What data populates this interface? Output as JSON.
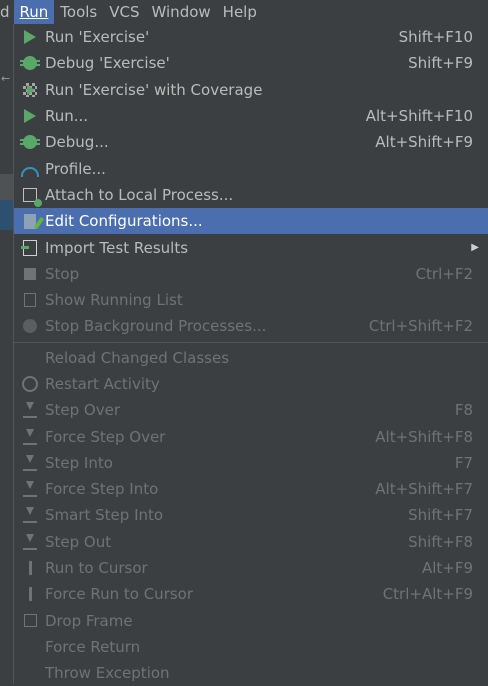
{
  "menubar": {
    "items": [
      {
        "label": "d",
        "underline": ""
      },
      {
        "label": "Run",
        "underline": "R"
      },
      {
        "label": "Tools",
        "underline": "T"
      },
      {
        "label": "VCS",
        "underline": ""
      },
      {
        "label": "Window",
        "underline": "W"
      },
      {
        "label": "Help",
        "underline": "H"
      }
    ]
  },
  "menu": {
    "items": [
      {
        "label": "Run 'Exercise'",
        "shortcut": "Shift+F10",
        "icon": "run-icon"
      },
      {
        "label": "Debug 'Exercise'",
        "shortcut": "Shift+F9",
        "icon": "debug-icon"
      },
      {
        "label": "Run 'Exercise' with Coverage",
        "shortcut": "",
        "icon": "coverage-icon"
      },
      {
        "label": "Run...",
        "shortcut": "Alt+Shift+F10",
        "icon": "run-icon"
      },
      {
        "label": "Debug...",
        "shortcut": "Alt+Shift+F9",
        "icon": "debug-icon"
      },
      {
        "label": "Profile...",
        "shortcut": "",
        "icon": "profile-icon"
      },
      {
        "label": "Attach to Local Process...",
        "shortcut": "",
        "icon": "attach-icon"
      },
      {
        "label": "Edit Configurations...",
        "shortcut": "",
        "icon": "edit-config-icon"
      },
      {
        "label": "Import Test Results",
        "shortcut": "",
        "icon": "import-icon"
      },
      {
        "label": "Stop",
        "shortcut": "Ctrl+F2",
        "icon": "stop-icon"
      },
      {
        "label": "Show Running List",
        "shortcut": "",
        "icon": "list-icon"
      },
      {
        "label": "Stop Background Processes...",
        "shortcut": "Ctrl+Shift+F2",
        "icon": "stop-background-icon"
      },
      {
        "label": "Reload Changed Classes",
        "shortcut": "",
        "icon": ""
      },
      {
        "label": "Restart Activity",
        "shortcut": "",
        "icon": "restart-icon"
      },
      {
        "label": "Step Over",
        "shortcut": "F8",
        "icon": "step-over-icon"
      },
      {
        "label": "Force Step Over",
        "shortcut": "Alt+Shift+F8",
        "icon": "force-step-over-icon"
      },
      {
        "label": "Step Into",
        "shortcut": "F7",
        "icon": "step-into-icon"
      },
      {
        "label": "Force Step Into",
        "shortcut": "Alt+Shift+F7",
        "icon": "force-step-into-icon"
      },
      {
        "label": "Smart Step Into",
        "shortcut": "Shift+F7",
        "icon": "smart-step-into-icon"
      },
      {
        "label": "Step Out",
        "shortcut": "Shift+F8",
        "icon": "step-out-icon"
      },
      {
        "label": "Run to Cursor",
        "shortcut": "Alt+F9",
        "icon": "run-to-cursor-icon"
      },
      {
        "label": "Force Run to Cursor",
        "shortcut": "Ctrl+Alt+F9",
        "icon": "force-run-to-cursor-icon"
      },
      {
        "label": "Drop Frame",
        "shortcut": "",
        "icon": "drop-frame-icon"
      },
      {
        "label": "Force Return",
        "shortcut": "",
        "icon": ""
      },
      {
        "label": "Throw Exception",
        "shortcut": "",
        "icon": ""
      }
    ]
  },
  "colors": {
    "background": "#3c3f41",
    "highlight": "#4b6eaf",
    "text": "#bbbbbb",
    "disabled_text": "#6f7375",
    "run_green": "#59a869"
  }
}
